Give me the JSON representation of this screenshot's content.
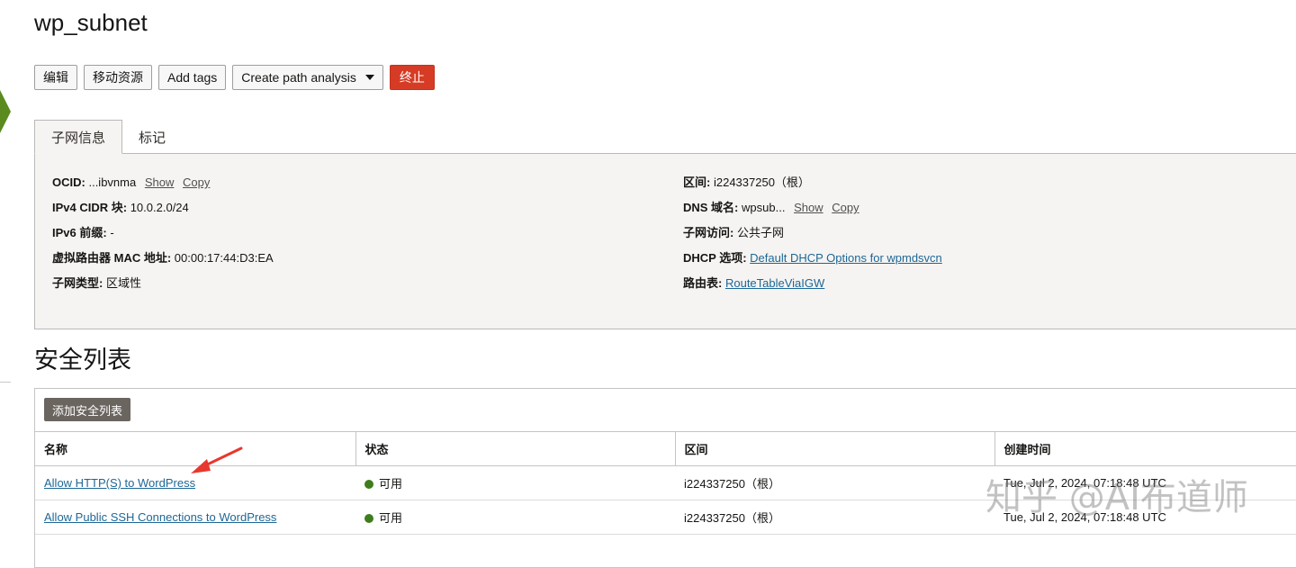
{
  "page": {
    "title": "wp_subnet"
  },
  "toolbar": {
    "edit": "编辑",
    "move": "移动资源",
    "add_tags": "Add tags",
    "path_analysis": "Create path analysis",
    "terminate": "终止"
  },
  "tabs": {
    "info": "子网信息",
    "tags": "标记"
  },
  "info": {
    "left": {
      "ocid_label": "OCID:",
      "ocid_value": "...ibvnma",
      "ocid_show": "Show",
      "ocid_copy": "Copy",
      "ipv4_label": "IPv4 CIDR 块:",
      "ipv4_value": "10.0.2.0/24",
      "ipv6_label": "IPv6 前缀:",
      "ipv6_value": "-",
      "mac_label": "虚拟路由器 MAC 地址:",
      "mac_value": "00:00:17:44:D3:EA",
      "type_label": "子网类型:",
      "type_value": "区域性"
    },
    "right": {
      "compartment_label": "区间:",
      "compartment_value": "i224337250（根）",
      "dns_label": "DNS 域名:",
      "dns_value": "wpsub...",
      "dns_show": "Show",
      "dns_copy": "Copy",
      "access_label": "子网访问:",
      "access_value": "公共子网",
      "dhcp_label": "DHCP 选项:",
      "dhcp_value": "Default DHCP Options for wpmdsvcn",
      "route_label": "路由表:",
      "route_value": "RouteTableViaIGW"
    }
  },
  "security_lists": {
    "title": "安全列表",
    "add_button": "添加安全列表",
    "columns": {
      "name": "名称",
      "status": "状态",
      "compartment": "区间",
      "created": "创建时间"
    },
    "rows": [
      {
        "name": "Allow HTTP(S) to WordPress",
        "status": "可用",
        "compartment": "i224337250（根）",
        "created": "Tue, Jul 2, 2024, 07:18:48 UTC"
      },
      {
        "name": "Allow Public SSH Connections to WordPress",
        "status": "可用",
        "compartment": "i224337250（根）",
        "created": "Tue, Jul 2, 2024, 07:18:48 UTC"
      }
    ]
  },
  "watermark": "知乎 @AI布道师",
  "colors": {
    "accent_danger": "#d63b25",
    "status_available": "#3e7d1e",
    "link": "#1e6796",
    "annotation_arrow": "#e8372e"
  }
}
